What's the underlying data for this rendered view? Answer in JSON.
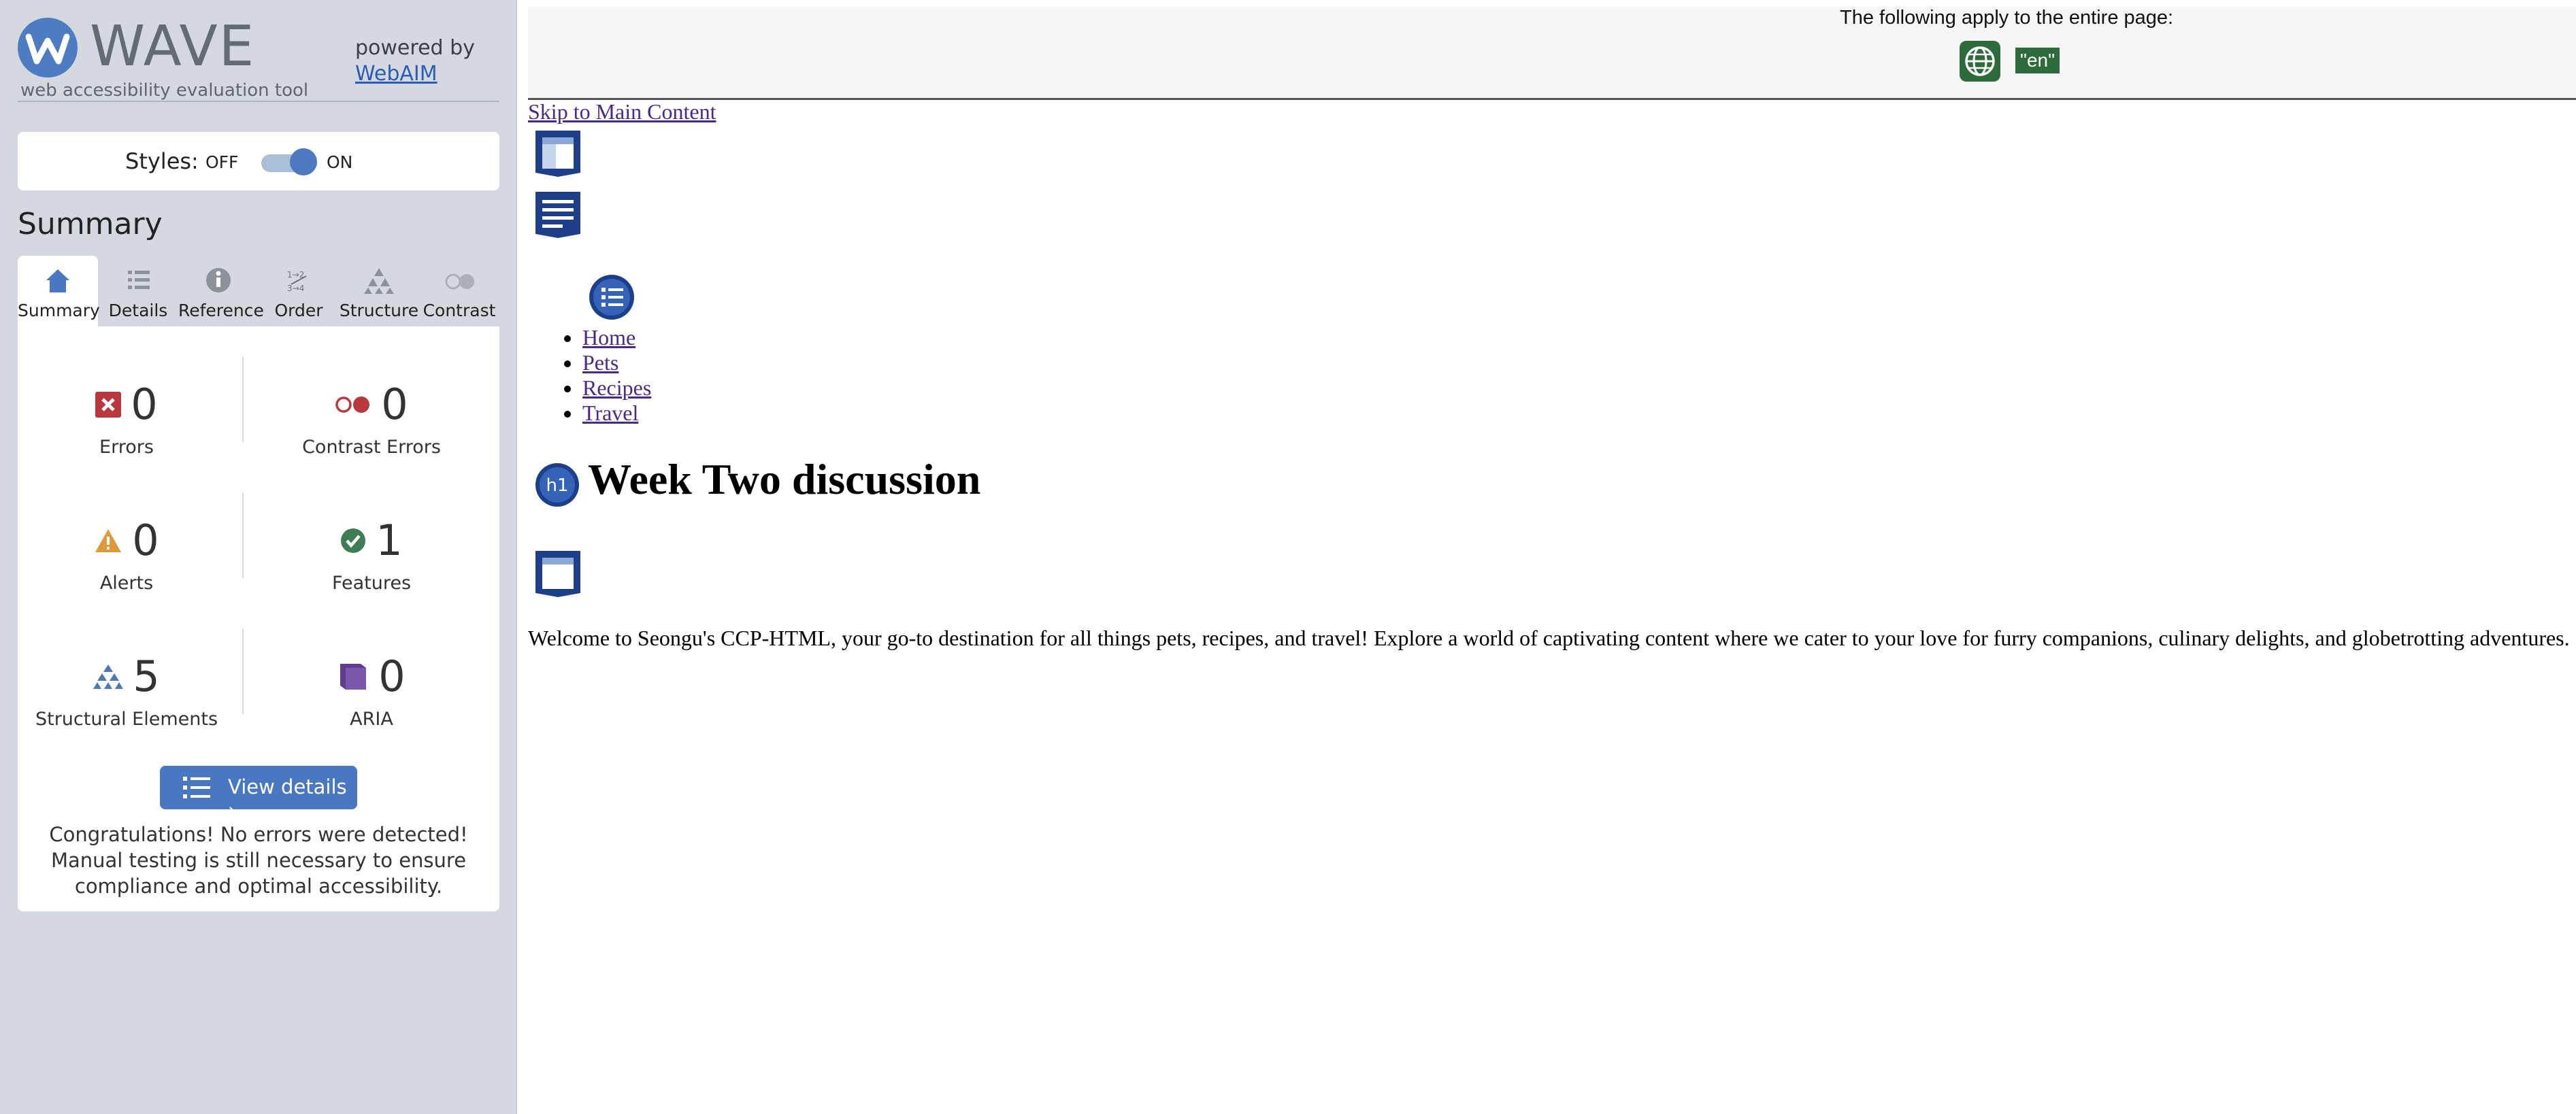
{
  "sidebar": {
    "logo_text": "WAVE",
    "logo_subtitle": "web accessibility evaluation tool",
    "powered_by": "powered by",
    "webaim_link": "WebAIM",
    "styles": {
      "label": "Styles:",
      "off": "OFF",
      "on": "ON",
      "state": "on"
    },
    "summary_title": "Summary",
    "tabs": [
      {
        "label": "Summary",
        "icon": "home-icon",
        "active": true
      },
      {
        "label": "Details",
        "icon": "list-icon",
        "active": false
      },
      {
        "label": "Reference",
        "icon": "info-icon",
        "active": false
      },
      {
        "label": "Order",
        "icon": "order-icon",
        "active": false
      },
      {
        "label": "Structure",
        "icon": "structure-icon",
        "active": false
      },
      {
        "label": "Contrast",
        "icon": "contrast-icon",
        "active": false
      }
    ],
    "stats": {
      "errors": {
        "count": "0",
        "label": "Errors",
        "color": "#b8383d"
      },
      "contrast_errors": {
        "count": "0",
        "label": "Contrast Errors",
        "color": "#b8383d"
      },
      "alerts": {
        "count": "0",
        "label": "Alerts",
        "color": "#dc9a3a"
      },
      "features": {
        "count": "1",
        "label": "Features",
        "color": "#3f7d54"
      },
      "structural": {
        "count": "5",
        "label": "Structural Elements",
        "color": "#4f78b0"
      },
      "aria": {
        "count": "0",
        "label": "ARIA",
        "color": "#5e3c8f"
      }
    },
    "view_details": "View details ›",
    "congrats": "Congratulations! No errors were detected! Manual testing is still necessary to ensure compliance and optimal accessibility."
  },
  "page": {
    "apply_text": "The following apply to the entire page:",
    "lang_badge": "\"en\"",
    "skip_link": "Skip to Main Content",
    "nav_items": [
      "Home",
      "Pets",
      "Recipes",
      "Travel"
    ],
    "h1_badge": "h1",
    "heading": "Week Two discussion",
    "intro": "Welcome to Seongu's CCP-HTML, your go-to destination for all things pets, recipes, and travel! Explore a world of captivating content where we cater to your love for furry companions, culinary delights, and globetrotting adventures."
  },
  "colors": {
    "sidebar_bg": "#d3d9de",
    "brand_blue": "#4e7cc1",
    "structure_icon_navy": "#1d3f8a",
    "language_green": "#2e6b3a",
    "link_purple": "#4b2a86"
  }
}
